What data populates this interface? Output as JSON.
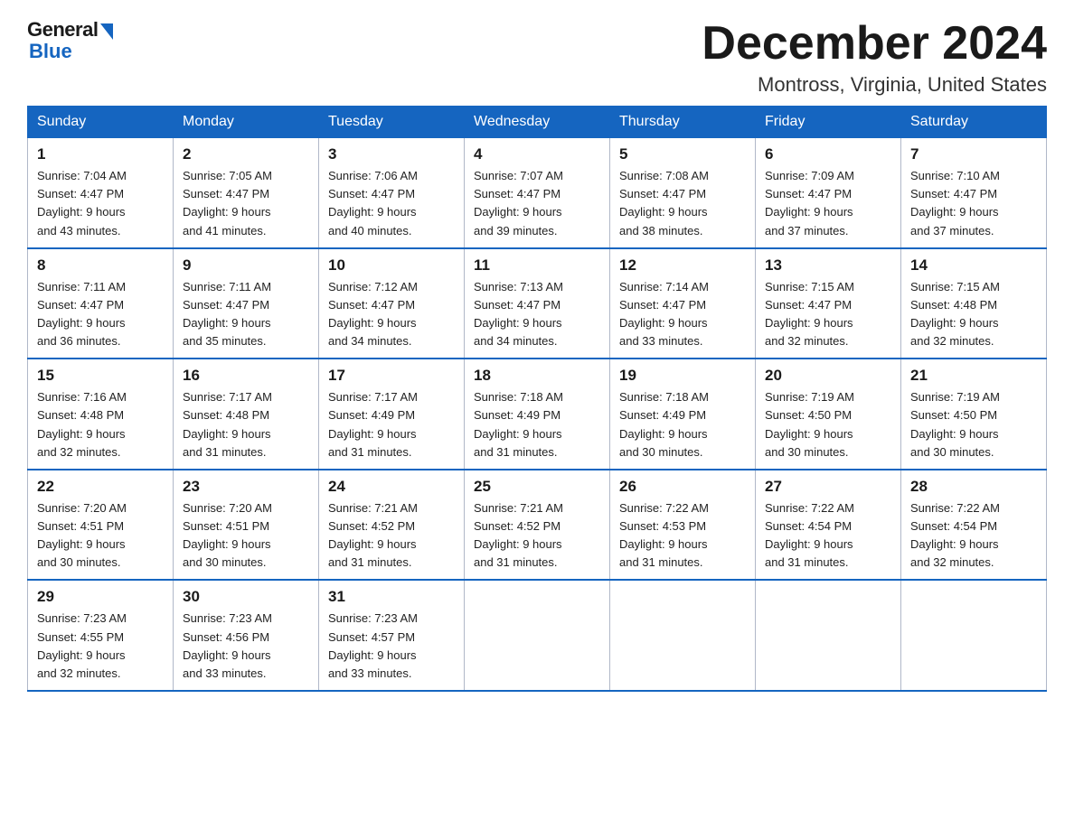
{
  "header": {
    "logo": {
      "general": "General",
      "blue": "Blue"
    },
    "title": "December 2024",
    "subtitle": "Montross, Virginia, United States"
  },
  "days_of_week": [
    "Sunday",
    "Monday",
    "Tuesday",
    "Wednesday",
    "Thursday",
    "Friday",
    "Saturday"
  ],
  "weeks": [
    [
      {
        "day": "1",
        "sunrise": "7:04 AM",
        "sunset": "4:47 PM",
        "daylight": "9 hours and 43 minutes."
      },
      {
        "day": "2",
        "sunrise": "7:05 AM",
        "sunset": "4:47 PM",
        "daylight": "9 hours and 41 minutes."
      },
      {
        "day": "3",
        "sunrise": "7:06 AM",
        "sunset": "4:47 PM",
        "daylight": "9 hours and 40 minutes."
      },
      {
        "day": "4",
        "sunrise": "7:07 AM",
        "sunset": "4:47 PM",
        "daylight": "9 hours and 39 minutes."
      },
      {
        "day": "5",
        "sunrise": "7:08 AM",
        "sunset": "4:47 PM",
        "daylight": "9 hours and 38 minutes."
      },
      {
        "day": "6",
        "sunrise": "7:09 AM",
        "sunset": "4:47 PM",
        "daylight": "9 hours and 37 minutes."
      },
      {
        "day": "7",
        "sunrise": "7:10 AM",
        "sunset": "4:47 PM",
        "daylight": "9 hours and 37 minutes."
      }
    ],
    [
      {
        "day": "8",
        "sunrise": "7:11 AM",
        "sunset": "4:47 PM",
        "daylight": "9 hours and 36 minutes."
      },
      {
        "day": "9",
        "sunrise": "7:11 AM",
        "sunset": "4:47 PM",
        "daylight": "9 hours and 35 minutes."
      },
      {
        "day": "10",
        "sunrise": "7:12 AM",
        "sunset": "4:47 PM",
        "daylight": "9 hours and 34 minutes."
      },
      {
        "day": "11",
        "sunrise": "7:13 AM",
        "sunset": "4:47 PM",
        "daylight": "9 hours and 34 minutes."
      },
      {
        "day": "12",
        "sunrise": "7:14 AM",
        "sunset": "4:47 PM",
        "daylight": "9 hours and 33 minutes."
      },
      {
        "day": "13",
        "sunrise": "7:15 AM",
        "sunset": "4:47 PM",
        "daylight": "9 hours and 32 minutes."
      },
      {
        "day": "14",
        "sunrise": "7:15 AM",
        "sunset": "4:48 PM",
        "daylight": "9 hours and 32 minutes."
      }
    ],
    [
      {
        "day": "15",
        "sunrise": "7:16 AM",
        "sunset": "4:48 PM",
        "daylight": "9 hours and 32 minutes."
      },
      {
        "day": "16",
        "sunrise": "7:17 AM",
        "sunset": "4:48 PM",
        "daylight": "9 hours and 31 minutes."
      },
      {
        "day": "17",
        "sunrise": "7:17 AM",
        "sunset": "4:49 PM",
        "daylight": "9 hours and 31 minutes."
      },
      {
        "day": "18",
        "sunrise": "7:18 AM",
        "sunset": "4:49 PM",
        "daylight": "9 hours and 31 minutes."
      },
      {
        "day": "19",
        "sunrise": "7:18 AM",
        "sunset": "4:49 PM",
        "daylight": "9 hours and 30 minutes."
      },
      {
        "day": "20",
        "sunrise": "7:19 AM",
        "sunset": "4:50 PM",
        "daylight": "9 hours and 30 minutes."
      },
      {
        "day": "21",
        "sunrise": "7:19 AM",
        "sunset": "4:50 PM",
        "daylight": "9 hours and 30 minutes."
      }
    ],
    [
      {
        "day": "22",
        "sunrise": "7:20 AM",
        "sunset": "4:51 PM",
        "daylight": "9 hours and 30 minutes."
      },
      {
        "day": "23",
        "sunrise": "7:20 AM",
        "sunset": "4:51 PM",
        "daylight": "9 hours and 30 minutes."
      },
      {
        "day": "24",
        "sunrise": "7:21 AM",
        "sunset": "4:52 PM",
        "daylight": "9 hours and 31 minutes."
      },
      {
        "day": "25",
        "sunrise": "7:21 AM",
        "sunset": "4:52 PM",
        "daylight": "9 hours and 31 minutes."
      },
      {
        "day": "26",
        "sunrise": "7:22 AM",
        "sunset": "4:53 PM",
        "daylight": "9 hours and 31 minutes."
      },
      {
        "day": "27",
        "sunrise": "7:22 AM",
        "sunset": "4:54 PM",
        "daylight": "9 hours and 31 minutes."
      },
      {
        "day": "28",
        "sunrise": "7:22 AM",
        "sunset": "4:54 PM",
        "daylight": "9 hours and 32 minutes."
      }
    ],
    [
      {
        "day": "29",
        "sunrise": "7:23 AM",
        "sunset": "4:55 PM",
        "daylight": "9 hours and 32 minutes."
      },
      {
        "day": "30",
        "sunrise": "7:23 AM",
        "sunset": "4:56 PM",
        "daylight": "9 hours and 33 minutes."
      },
      {
        "day": "31",
        "sunrise": "7:23 AM",
        "sunset": "4:57 PM",
        "daylight": "9 hours and 33 minutes."
      },
      null,
      null,
      null,
      null
    ]
  ],
  "labels": {
    "sunrise": "Sunrise:",
    "sunset": "Sunset:",
    "daylight": "Daylight:"
  }
}
